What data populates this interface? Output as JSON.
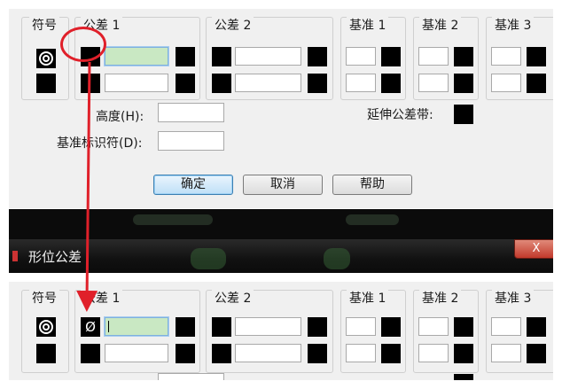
{
  "dialog": {
    "title": "形位公差",
    "close_label": "X",
    "columns": {
      "symbol": "符号",
      "tol1": "公差 1",
      "tol2": "公差 2",
      "datum1": "基准 1",
      "datum2": "基准 2",
      "datum3": "基准 3"
    },
    "height_label": "高度(H):",
    "projected_zone_label": "延伸公差带:",
    "datum_identifier_label": "基准标识符(D):",
    "buttons": {
      "ok": "确定",
      "cancel": "取消",
      "help": "帮助"
    }
  },
  "after": {
    "diameter_symbol": "Ø"
  },
  "annotation": {
    "color": "#e0202a"
  }
}
